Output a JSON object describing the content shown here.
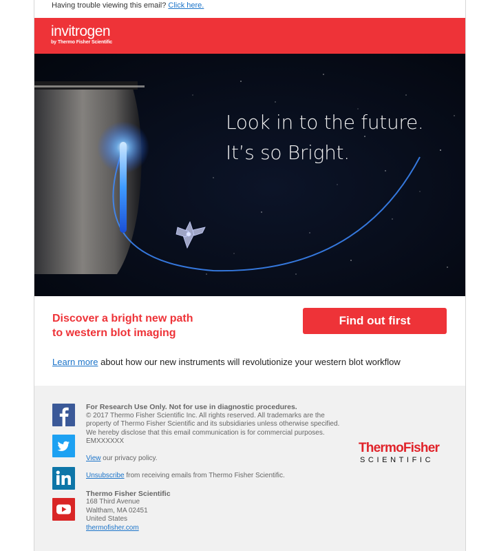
{
  "top_notice": {
    "text": "Having trouble viewing this email?",
    "link": "Click here."
  },
  "header": {
    "brand": "invitrogen",
    "brand_sub": "by Thermo Fisher Scientific",
    "color": "#ee3338"
  },
  "hero": {
    "line1": "Look in to the future.",
    "line2": "It’s so Bright."
  },
  "promo": {
    "headline_line1": "Discover a bright new path",
    "headline_line2": "to western blot imaging",
    "cta_label": "Find out first",
    "learn_more_link": "Learn more",
    "learn_more_text": " about how our new instruments will revolutionize your western blot workflow"
  },
  "footer": {
    "research_notice": "For Research Use Only. Not for use in diagnostic procedures.",
    "copyright": "© 2017 Thermo Fisher Scientific Inc. All rights reserved. All trademarks are the property of Thermo Fisher Scientific and its subsidiaries unless otherwise specified. We hereby disclose that this email communication is for commercial purposes.",
    "code": "EMXXXXXX",
    "privacy_link": "View",
    "privacy_text": " our privacy policy.",
    "unsubscribe_link": "Unsubscribe",
    "unsubscribe_text": " from receiving emails from Thermo Fisher Scientific.",
    "company": "Thermo Fisher Scientific",
    "address1": "168 Third Avenue",
    "address2": "Waltham, MA 02451",
    "address3": "United States",
    "website": "thermofisher.com",
    "logo_name": "ThermoFisher",
    "logo_sub": "SCIENTIFIC",
    "social": [
      "facebook-icon",
      "twitter-icon",
      "linkedin-icon",
      "youtube-icon"
    ]
  }
}
